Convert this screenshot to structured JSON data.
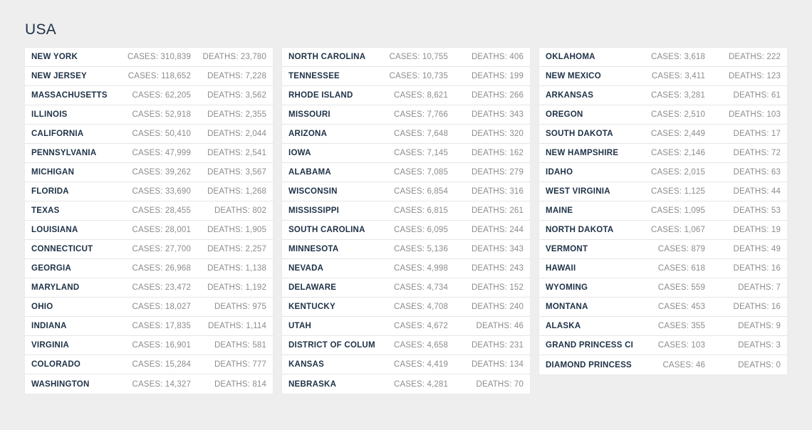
{
  "header": {
    "title": "USA",
    "title_color": "#1e3146"
  },
  "labels": {
    "cases_prefix": "CASES:",
    "deaths_prefix": "DEATHS:"
  },
  "theme": {
    "background": "#eeeeee",
    "card_background": "#ffffff",
    "region_text": "#1e3146",
    "metric_text": "#8c8c8c",
    "row_divider": "#e6e6e6"
  },
  "columns": [
    {
      "rows": [
        {
          "region": "NEW YORK",
          "cases": "CASES: 310,839",
          "deaths": "DEATHS: 23,780"
        },
        {
          "region": "NEW JERSEY",
          "cases": "CASES: 118,652",
          "deaths": "DEATHS: 7,228"
        },
        {
          "region": "MASSACHUSETTS",
          "cases": "CASES: 62,205",
          "deaths": "DEATHS: 3,562"
        },
        {
          "region": "ILLINOIS",
          "cases": "CASES: 52,918",
          "deaths": "DEATHS: 2,355"
        },
        {
          "region": "CALIFORNIA",
          "cases": "CASES: 50,410",
          "deaths": "DEATHS: 2,044"
        },
        {
          "region": "PENNSYLVANIA",
          "cases": "CASES: 47,999",
          "deaths": "DEATHS: 2,541"
        },
        {
          "region": "MICHIGAN",
          "cases": "CASES: 39,262",
          "deaths": "DEATHS: 3,567"
        },
        {
          "region": "FLORIDA",
          "cases": "CASES: 33,690",
          "deaths": "DEATHS: 1,268"
        },
        {
          "region": "TEXAS",
          "cases": "CASES: 28,455",
          "deaths": "DEATHS: 802"
        },
        {
          "region": "LOUISIANA",
          "cases": "CASES: 28,001",
          "deaths": "DEATHS: 1,905"
        },
        {
          "region": "CONNECTICUT",
          "cases": "CASES: 27,700",
          "deaths": "DEATHS: 2,257"
        },
        {
          "region": "GEORGIA",
          "cases": "CASES: 26,968",
          "deaths": "DEATHS: 1,138"
        },
        {
          "region": "MARYLAND",
          "cases": "CASES: 23,472",
          "deaths": "DEATHS: 1,192"
        },
        {
          "region": "OHIO",
          "cases": "CASES: 18,027",
          "deaths": "DEATHS: 975"
        },
        {
          "region": "INDIANA",
          "cases": "CASES: 17,835",
          "deaths": "DEATHS: 1,114"
        },
        {
          "region": "VIRGINIA",
          "cases": "CASES: 16,901",
          "deaths": "DEATHS: 581"
        },
        {
          "region": "COLORADO",
          "cases": "CASES: 15,284",
          "deaths": "DEATHS: 777"
        },
        {
          "region": "WASHINGTON",
          "cases": "CASES: 14,327",
          "deaths": "DEATHS: 814"
        }
      ]
    },
    {
      "rows": [
        {
          "region": "NORTH CAROLINA",
          "cases": "CASES: 10,755",
          "deaths": "DEATHS: 406"
        },
        {
          "region": "TENNESSEE",
          "cases": "CASES: 10,735",
          "deaths": "DEATHS: 199"
        },
        {
          "region": "RHODE ISLAND",
          "cases": "CASES: 8,621",
          "deaths": "DEATHS: 266"
        },
        {
          "region": "MISSOURI",
          "cases": "CASES: 7,766",
          "deaths": "DEATHS: 343"
        },
        {
          "region": "ARIZONA",
          "cases": "CASES: 7,648",
          "deaths": "DEATHS: 320"
        },
        {
          "region": "IOWA",
          "cases": "CASES: 7,145",
          "deaths": "DEATHS: 162"
        },
        {
          "region": "ALABAMA",
          "cases": "CASES: 7,085",
          "deaths": "DEATHS: 279"
        },
        {
          "region": "WISCONSIN",
          "cases": "CASES: 6,854",
          "deaths": "DEATHS: 316"
        },
        {
          "region": "MISSISSIPPI",
          "cases": "CASES: 6,815",
          "deaths": "DEATHS: 261"
        },
        {
          "region": "SOUTH CAROLINA",
          "cases": "CASES: 6,095",
          "deaths": "DEATHS: 244"
        },
        {
          "region": "MINNESOTA",
          "cases": "CASES: 5,136",
          "deaths": "DEATHS: 343"
        },
        {
          "region": "NEVADA",
          "cases": "CASES: 4,998",
          "deaths": "DEATHS: 243"
        },
        {
          "region": "DELAWARE",
          "cases": "CASES: 4,734",
          "deaths": "DEATHS: 152"
        },
        {
          "region": "KENTUCKY",
          "cases": "CASES: 4,708",
          "deaths": "DEATHS: 240"
        },
        {
          "region": "UTAH",
          "cases": "CASES: 4,672",
          "deaths": "DEATHS: 46"
        },
        {
          "region": "DISTRICT OF COLUMBIA",
          "cases": "CASES: 4,658",
          "deaths": "DEATHS: 231"
        },
        {
          "region": "KANSAS",
          "cases": "CASES: 4,419",
          "deaths": "DEATHS: 134"
        },
        {
          "region": "NEBRASKA",
          "cases": "CASES: 4,281",
          "deaths": "DEATHS: 70"
        }
      ]
    },
    {
      "rows": [
        {
          "region": "OKLAHOMA",
          "cases": "CASES: 3,618",
          "deaths": "DEATHS: 222"
        },
        {
          "region": "NEW MEXICO",
          "cases": "CASES: 3,411",
          "deaths": "DEATHS: 123"
        },
        {
          "region": "ARKANSAS",
          "cases": "CASES: 3,281",
          "deaths": "DEATHS: 61"
        },
        {
          "region": "OREGON",
          "cases": "CASES: 2,510",
          "deaths": "DEATHS: 103"
        },
        {
          "region": "SOUTH DAKOTA",
          "cases": "CASES: 2,449",
          "deaths": "DEATHS: 17"
        },
        {
          "region": "NEW HAMPSHIRE",
          "cases": "CASES: 2,146",
          "deaths": "DEATHS: 72"
        },
        {
          "region": "IDAHO",
          "cases": "CASES: 2,015",
          "deaths": "DEATHS: 63"
        },
        {
          "region": "WEST VIRGINIA",
          "cases": "CASES: 1,125",
          "deaths": "DEATHS: 44"
        },
        {
          "region": "MAINE",
          "cases": "CASES: 1,095",
          "deaths": "DEATHS: 53"
        },
        {
          "region": "NORTH DAKOTA",
          "cases": "CASES: 1,067",
          "deaths": "DEATHS: 19"
        },
        {
          "region": "VERMONT",
          "cases": "CASES: 879",
          "deaths": "DEATHS: 49"
        },
        {
          "region": "HAWAII",
          "cases": "CASES: 618",
          "deaths": "DEATHS: 16"
        },
        {
          "region": "WYOMING",
          "cases": "CASES: 559",
          "deaths": "DEATHS: 7"
        },
        {
          "region": "MONTANA",
          "cases": "CASES: 453",
          "deaths": "DEATHS: 16"
        },
        {
          "region": "ALASKA",
          "cases": "CASES: 355",
          "deaths": "DEATHS: 9"
        },
        {
          "region": "GRAND PRINCESS CRUISE",
          "cases": "CASES: 103",
          "deaths": "DEATHS: 3"
        },
        {
          "region": "DIAMOND PRINCESS CRUISE",
          "cases": "CASES: 46",
          "deaths": "DEATHS: 0"
        }
      ]
    }
  ]
}
